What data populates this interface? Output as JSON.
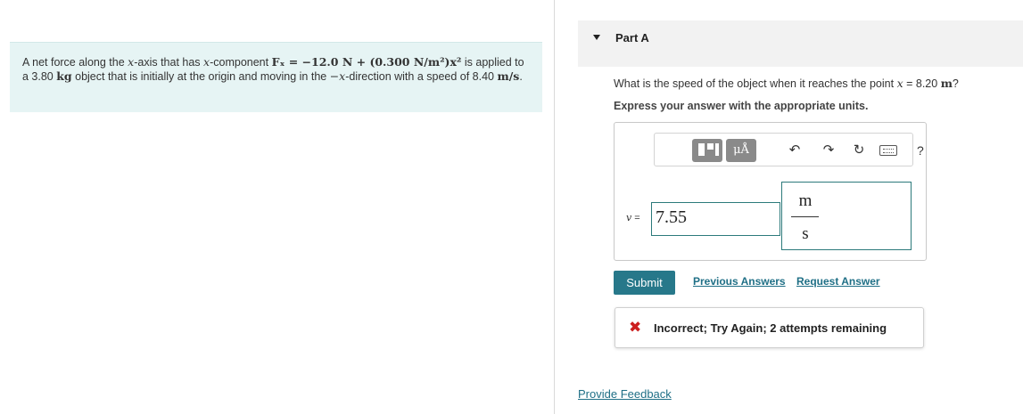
{
  "problem": {
    "text1": "A net force along the ",
    "x1": "x",
    "text2": "-axis that has ",
    "x2": "x",
    "text3": "-component ",
    "force_formula": "Fₓ = −12.0 N + (0.300 N/m²)x²",
    "text4": " is applied to a 3.80 ",
    "kg": "kg",
    "text5": " object that is initially at the origin and moving in the ",
    "negx": "−x",
    "text6": "-direction with a speed of 8.40 ",
    "ms": "m/s",
    "text7": "."
  },
  "part": {
    "label": "Part A",
    "question_prefix": "What is the speed of the object when it reaches the point ",
    "question_x": "x",
    "question_value": " = 8.20 ",
    "question_unit": "m",
    "question_suffix": "?",
    "instruction": "Express your answer with the appropriate units."
  },
  "toolbar": {
    "units_label": "μÅ",
    "undo_glyph": "↶",
    "redo_glyph": "↷",
    "reset_glyph": "↻",
    "help_label": "?"
  },
  "answer": {
    "variable": "v",
    "equals": " =",
    "value": "7.55",
    "unit_numerator": "m",
    "unit_denominator": "s"
  },
  "actions": {
    "submit": "Submit",
    "previous_answers": "Previous Answers",
    "request_answer": "Request Answer"
  },
  "feedback": {
    "icon": "✖",
    "message": "Incorrect; Try Again; 2 attempts remaining"
  },
  "footer": {
    "provide_feedback": "Provide Feedback"
  },
  "colors": {
    "problem_bg": "#e6f4f4",
    "accent": "#27788a",
    "link": "#1f6f86",
    "error": "#cc1f1f",
    "input_border": "#2c7a7b"
  }
}
